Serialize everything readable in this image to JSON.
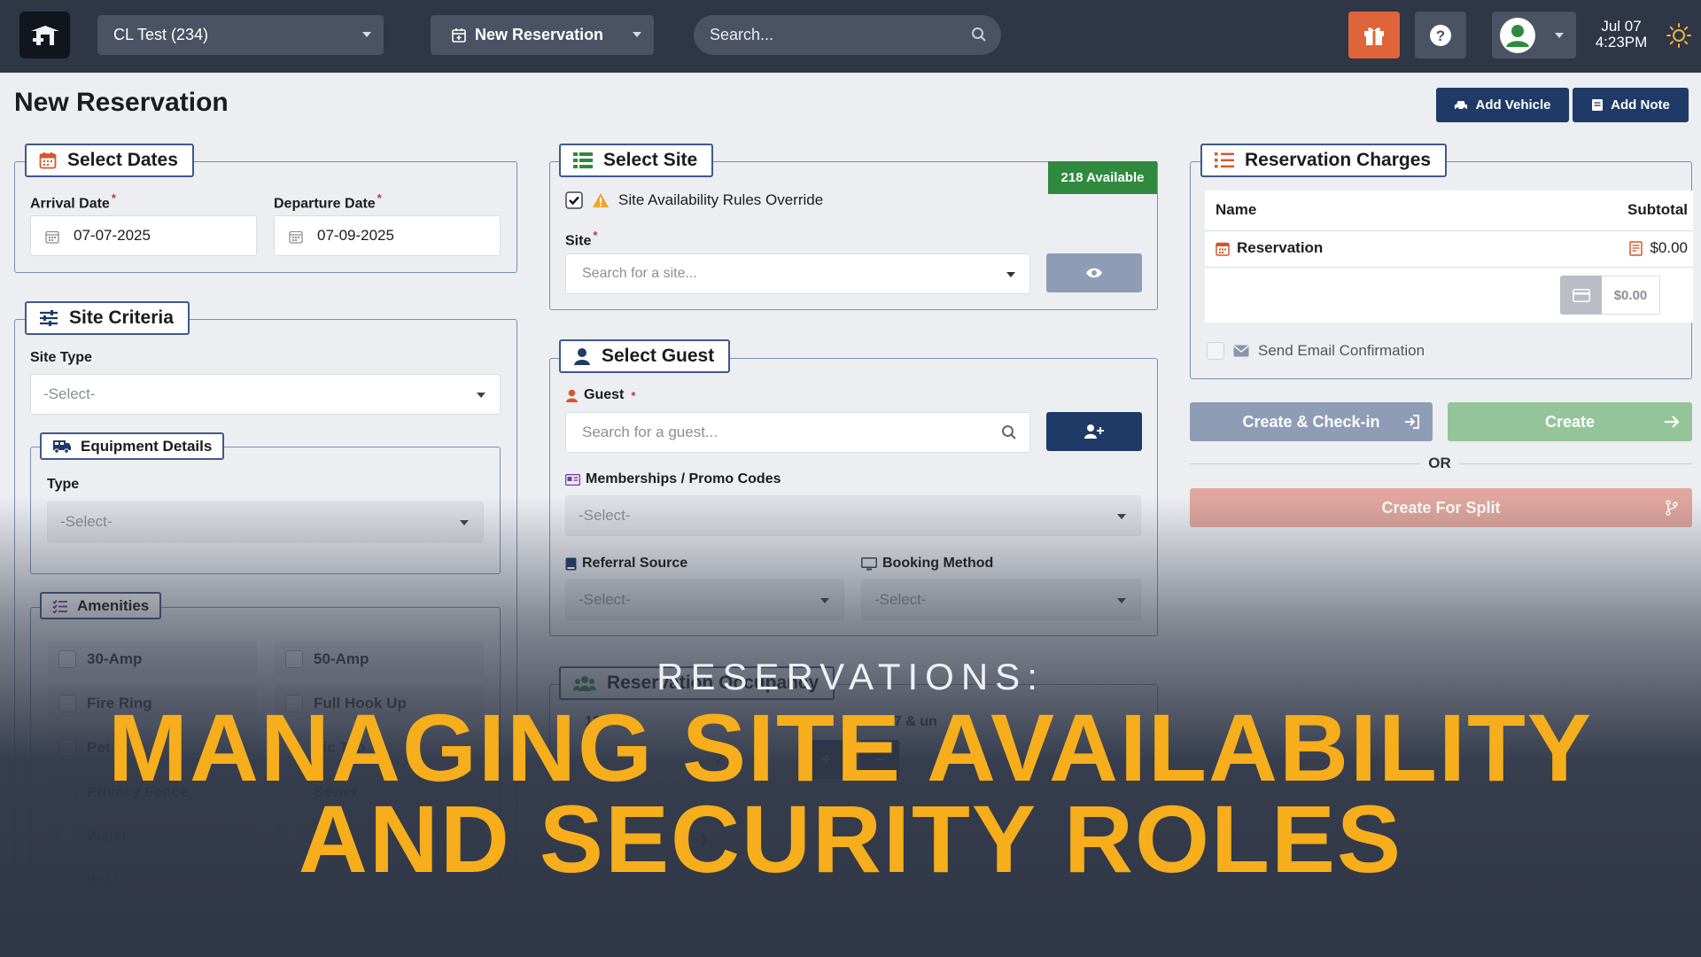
{
  "topbar": {
    "campground": "CL Test (234)",
    "new_reservation": "New Reservation",
    "search_placeholder": "Search...",
    "date": "Jul 07",
    "time": "4:23PM"
  },
  "page": {
    "title": "New Reservation",
    "add_vehicle": "Add Vehicle",
    "add_note": "Add Note"
  },
  "select_dates": {
    "title": "Select Dates",
    "arrival_label": "Arrival Date",
    "arrival_value": "07-07-2025",
    "departure_label": "Departure Date",
    "departure_value": "07-09-2025"
  },
  "site_criteria": {
    "title": "Site Criteria",
    "site_type_label": "Site Type",
    "site_type_value": "-Select-",
    "equipment_title": "Equipment Details",
    "type_label": "Type",
    "type_value": "-Select-",
    "amenities_title": "Amenities",
    "amenities": [
      "30-Amp",
      "50-Amp",
      "Fire Ring",
      "Full Hook Up",
      "Pet Fr",
      "nic Tab",
      "Privacy Fence",
      "Sewer",
      "Water",
      "W",
      "WiFi"
    ]
  },
  "select_site": {
    "title": "Select Site",
    "available_badge": "218 Available",
    "override_label": "Site Availability Rules Override",
    "override_checked": true,
    "site_label": "Site",
    "site_placeholder": "Search for a site..."
  },
  "select_guest": {
    "title": "Select Guest",
    "guest_label": "Guest",
    "guest_placeholder": "Search for a guest...",
    "memberships_label": "Memberships / Promo Codes",
    "memberships_value": "-Select-",
    "referral_label": "Referral Source",
    "referral_value": "-Select-",
    "booking_label": "Booking Method",
    "booking_value": "-Select-"
  },
  "occupancy": {
    "title": "Reservation Occupancy",
    "partial_1": "13 & o",
    "partial_2": "17 & un",
    "value": "2",
    "plus": "+",
    "minus": "−",
    "partial_3": "1"
  },
  "charges": {
    "title": "Reservation Charges",
    "col_name": "Name",
    "col_subtotal": "Subtotal",
    "row_name": "Reservation",
    "row_value": "$0.00",
    "total_value": "$0.00",
    "send_email": "Send Email Confirmation"
  },
  "actions": {
    "create_checkin": "Create & Check-in",
    "create": "Create",
    "or": "OR",
    "create_split": "Create For Split"
  },
  "overlay": {
    "subtitle": "RESERVATIONS:",
    "line1": "MANAGING SITE AVAILABILITY",
    "line2": "AND SECURITY ROLES"
  },
  "colors": {
    "topbar": "#2f3646",
    "navy": "#1f3a66",
    "gift": "#e0643a",
    "available_green": "#2f8a3e",
    "overlay_title": "#f6ae1c"
  }
}
